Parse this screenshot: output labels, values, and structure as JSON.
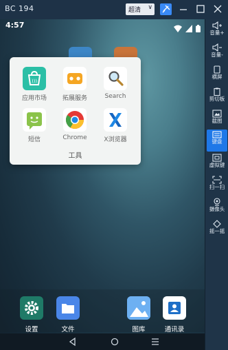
{
  "window": {
    "title": "BC 194",
    "mode_label": "超清",
    "pin_icon": "pin-icon",
    "buttons": [
      "minimize-icon",
      "maximize-icon",
      "close-icon"
    ]
  },
  "toolbar": {
    "items": [
      {
        "label": "音量+",
        "icon": "volume-up-icon"
      },
      {
        "label": "音量-",
        "icon": "volume-down-icon"
      },
      {
        "label": "横屏",
        "icon": "rotate-icon"
      },
      {
        "label": "剪切板",
        "icon": "clipboard-icon"
      },
      {
        "label": "截图",
        "icon": "screenshot-icon"
      },
      {
        "label": "键盘",
        "icon": "keyboard-icon"
      },
      {
        "label": "虚拟键",
        "icon": "virtual-keys-icon"
      },
      {
        "label": "扫一扫",
        "icon": "scan-icon"
      },
      {
        "label": "摄像头",
        "icon": "camera-icon"
      },
      {
        "label": "摇一摇",
        "icon": "shake-icon"
      }
    ],
    "active_index": 5,
    "accent": "#1e78e8"
  },
  "status_bar": {
    "time": "4:57",
    "icons": [
      "wifi-icon",
      "signal-icon",
      "battery-icon"
    ]
  },
  "folder": {
    "name": "工具",
    "apps": [
      {
        "label": "应用市场",
        "icon": "app-market-icon",
        "color": "#2bbfa6"
      },
      {
        "label": "拓展服务",
        "icon": "gamepad-icon",
        "color": "#f5a623"
      },
      {
        "label": "Search",
        "icon": "search-icon",
        "color": "#ffffff"
      },
      {
        "label": "短信",
        "icon": "message-icon",
        "color": "#8bc34a"
      },
      {
        "label": "Chrome",
        "icon": "chrome-icon",
        "color": "#ffffff"
      },
      {
        "label": "X浏览器",
        "icon": "x-browser-icon",
        "color": "#ffffff"
      }
    ]
  },
  "dock": {
    "apps": [
      {
        "label": "设置",
        "icon": "settings-icon",
        "color": "#1f7a67"
      },
      {
        "label": "文件",
        "icon": "files-icon",
        "color": "#4a86e8"
      },
      {
        "label": "图库",
        "icon": "gallery-icon",
        "color": "#5aa0ea"
      },
      {
        "label": "通讯录",
        "icon": "contacts-icon",
        "color": "#ffffff"
      }
    ]
  },
  "nav_bar": {
    "buttons": [
      "back-icon",
      "home-icon",
      "recents-icon"
    ]
  }
}
